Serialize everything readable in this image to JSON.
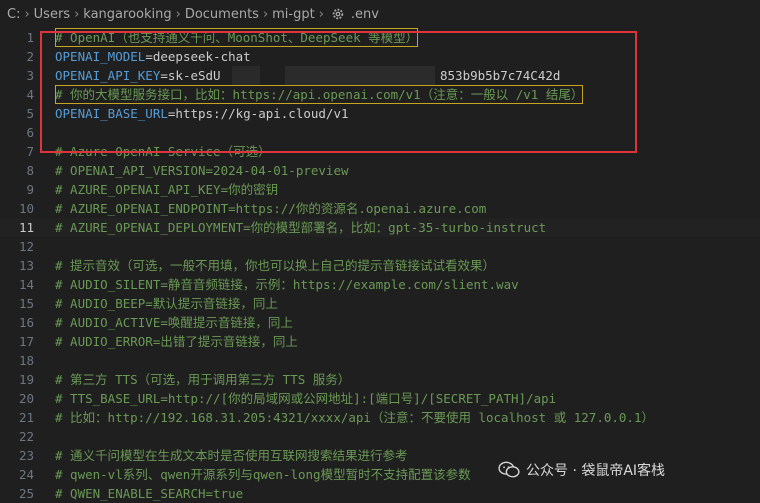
{
  "breadcrumb": {
    "items": [
      "C:",
      "Users",
      "kangarooking",
      "Documents",
      "mi-gpt"
    ],
    "file": ".env"
  },
  "editor": {
    "lines": [
      {
        "n": "1",
        "comment": "# OpenAI（也支持通义千问、MoonShot、DeepSeek 等模型）"
      },
      {
        "n": "2",
        "key": "OPENAI_MODEL",
        "value": "deepseek-chat"
      },
      {
        "n": "3",
        "key": "OPENAI_API_KEY",
        "value": "sk-eSdU",
        "value_tail": "853b9b5b7c74C42d"
      },
      {
        "n": "4",
        "comment": "# 你的大模型服务接口，比如：https://api.openai.com/v1（注意：一般以 /v1 结尾）"
      },
      {
        "n": "5",
        "key": "OPENAI_BASE_URL",
        "value": "https://kg-api.cloud/v1"
      },
      {
        "n": "6"
      },
      {
        "n": "7",
        "comment": "# Azure OpenAI Service（可选）"
      },
      {
        "n": "8",
        "comment": "# OPENAI_API_VERSION=2024-04-01-preview"
      },
      {
        "n": "9",
        "comment": "# AZURE_OPENAI_API_KEY=你的密钥"
      },
      {
        "n": "10",
        "comment": "# AZURE_OPENAI_ENDPOINT=https://你的资源名.openai.azure.com"
      },
      {
        "n": "11",
        "comment": "# AZURE_OPENAI_DEPLOYMENT=你的模型部署名，比如：gpt-35-turbo-instruct"
      },
      {
        "n": "12"
      },
      {
        "n": "13",
        "comment": "# 提示音效（可选，一般不用填，你也可以换上自己的提示音链接试试看效果）"
      },
      {
        "n": "14",
        "comment": "# AUDIO_SILENT=静音音频链接，示例：https://example.com/slient.wav"
      },
      {
        "n": "15",
        "comment": "# AUDIO_BEEP=默认提示音链接，同上"
      },
      {
        "n": "16",
        "comment": "# AUDIO_ACTIVE=唤醒提示音链接，同上"
      },
      {
        "n": "17",
        "comment": "# AUDIO_ERROR=出错了提示音链接，同上"
      },
      {
        "n": "18"
      },
      {
        "n": "19",
        "comment": "# 第三方 TTS（可选，用于调用第三方 TTS 服务）"
      },
      {
        "n": "20",
        "comment": "# TTS_BASE_URL=http://[你的局域网或公网地址]:[端口号]/[SECRET_PATH]/api"
      },
      {
        "n": "21",
        "comment": "# 比如：http://192.168.31.205:4321/xxxx/api（注意：不要使用 localhost 或 127.0.0.1）"
      },
      {
        "n": "22"
      },
      {
        "n": "23",
        "comment": "# 通义千问模型在生成文本时是否使用互联网搜索结果进行参考"
      },
      {
        "n": "24",
        "comment": "# qwen-vl系列、qwen开源系列与qwen-long模型暂时不支持配置该参数"
      },
      {
        "n": "25",
        "comment": "# QWEN_ENABLE_SEARCH=true"
      }
    ],
    "active_line": "11"
  },
  "watermark": {
    "text": "公众号 · 袋鼠帝AI客栈"
  },
  "colors": {
    "background": "#1f1f1f",
    "comment": "#6a9955",
    "key": "#569cd6",
    "highlight_box": "#c7a521",
    "annotation_box": "#e0343c"
  }
}
